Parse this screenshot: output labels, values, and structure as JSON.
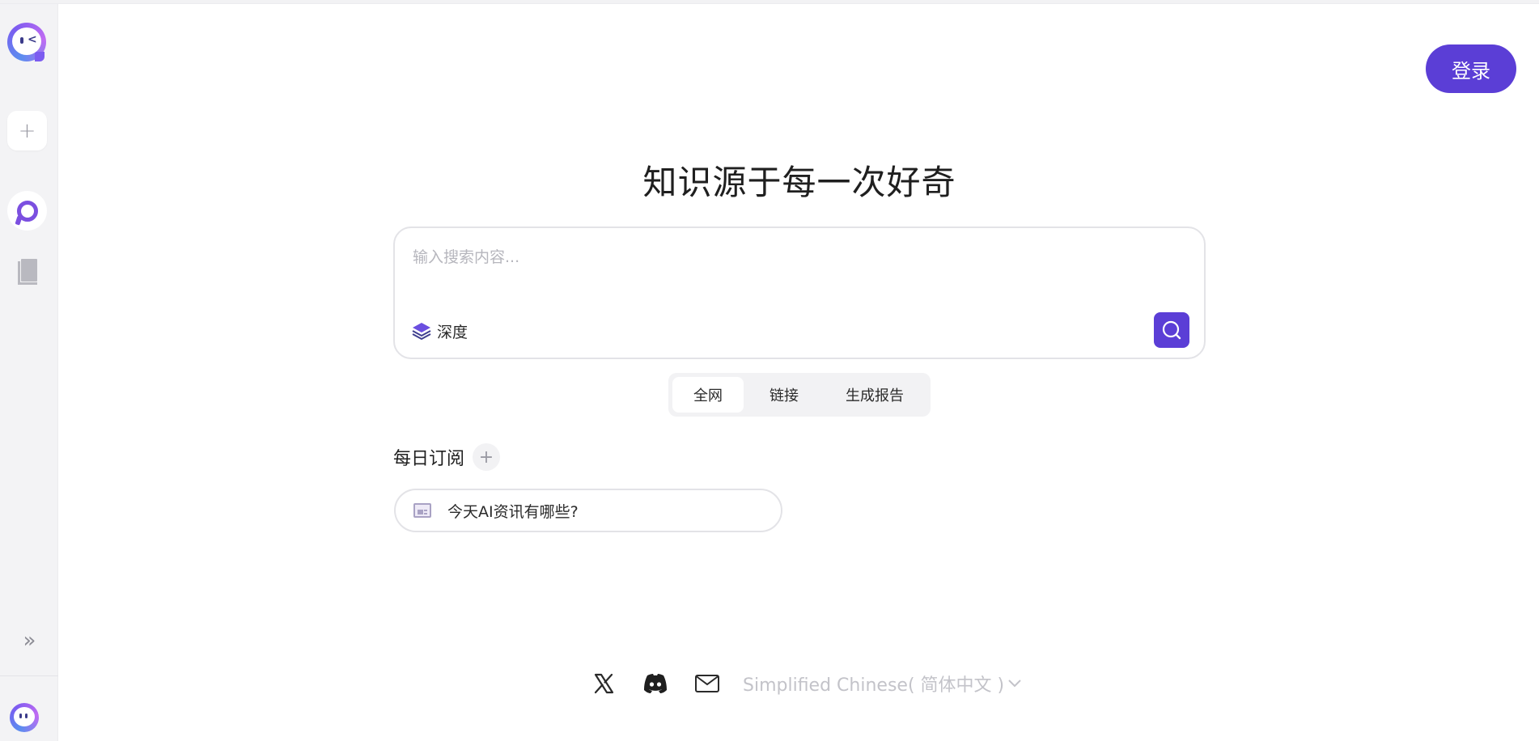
{
  "sidebar": {
    "items": [
      {
        "name": "new-chat",
        "icon": "plus-icon"
      },
      {
        "name": "search",
        "icon": "search-logo-icon"
      },
      {
        "name": "library",
        "icon": "book-icon"
      },
      {
        "name": "expand",
        "icon": "double-chevron-right-icon",
        "label": "»"
      }
    ],
    "new_label": "+"
  },
  "header": {
    "login_label": "登录"
  },
  "main": {
    "title": "知识源于每一次好奇",
    "search": {
      "placeholder": "输入搜索内容...",
      "value": "",
      "deep_label": "深度"
    },
    "modes": [
      {
        "label": "全网",
        "active": true
      },
      {
        "label": "链接",
        "active": false
      },
      {
        "label": "生成报告",
        "active": false
      }
    ],
    "daily": {
      "title": "每日订阅",
      "add_label": "+",
      "items": [
        {
          "label": "今天AI资讯有哪些?",
          "icon": "news-icon"
        }
      ]
    }
  },
  "footer": {
    "icons": [
      "x-icon",
      "discord-icon",
      "mail-icon"
    ],
    "language": "Simplified Chinese( 简体中文 )"
  },
  "colors": {
    "accent": "#5b3ed6",
    "sidebar_bg": "#f3f3f5",
    "border": "#e3e3e7"
  }
}
